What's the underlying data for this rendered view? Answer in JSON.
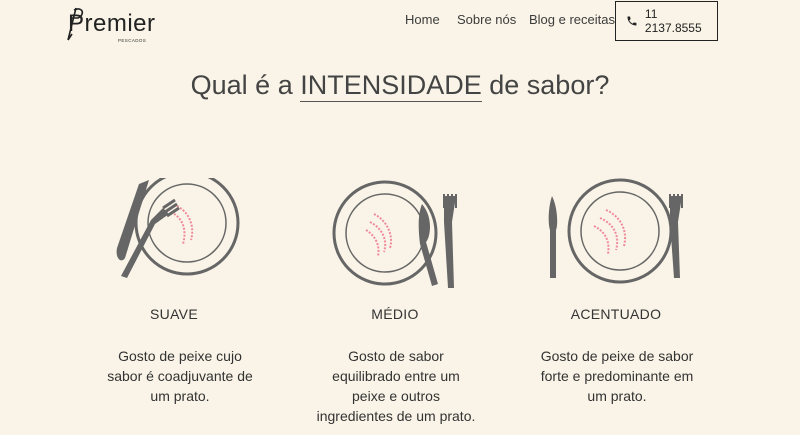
{
  "header": {
    "logo_text": "Premier",
    "logo_sub": "PESCADOS",
    "nav": [
      "Home",
      "Sobre nós",
      "Blog e receitas"
    ],
    "phone": "11 2137.8555"
  },
  "heading": {
    "prefix": "Qual é a ",
    "highlight": "INTENSIDADE",
    "suffix": " de sabor?"
  },
  "levels": [
    {
      "title": "SUAVE",
      "desc": "Gosto de peixe cujo sabor é coadjuvante de um prato."
    },
    {
      "title": "MÉDIO",
      "desc": "Gosto de sabor equilibrado entre um peixe e outros ingredientes de um prato."
    },
    {
      "title": "ACENTUADO",
      "desc": "Gosto de peixe de sabor forte e predominante em um prato."
    }
  ],
  "colors": {
    "background": "#f9f4e7",
    "plate": "#666666",
    "sauce": "#f08a9a"
  }
}
